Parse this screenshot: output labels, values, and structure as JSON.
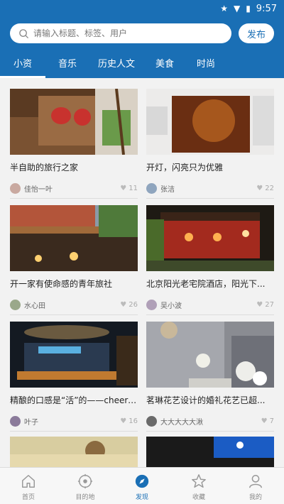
{
  "status": {
    "time": "9:57"
  },
  "search": {
    "placeholder": "请输入标题、标签、用户"
  },
  "header": {
    "publish_label": "发布"
  },
  "tabs": [
    "小资",
    "音乐",
    "历史人文",
    "美食",
    "时尚"
  ],
  "colors": {
    "primary": "#1a6fb5"
  },
  "cards": [
    {
      "title": "半自助的旅行之家",
      "user": "佳怡一叶",
      "likes": "11"
    },
    {
      "title": "开灯，闪亮只为优雅",
      "user": "张洁",
      "likes": "22"
    },
    {
      "title": "开一家有使命感的青年旅社",
      "user": "水心田",
      "likes": "26"
    },
    {
      "title": "北京阳光老宅院酒店，阳光下...",
      "user": "吴小波",
      "likes": "27"
    },
    {
      "title": "精酿的口感是“活”的——cheerd...",
      "user": "叶子",
      "likes": "16"
    },
    {
      "title": "茗琳花艺设计的婚礼花艺已超...",
      "user": "大大大大大湫",
      "likes": "7"
    }
  ],
  "nav": [
    {
      "label": "首页",
      "icon": "home-icon"
    },
    {
      "label": "目的地",
      "icon": "target-icon"
    },
    {
      "label": "发现",
      "icon": "compass-icon"
    },
    {
      "label": "收藏",
      "icon": "star-icon"
    },
    {
      "label": "我的",
      "icon": "user-icon"
    }
  ]
}
